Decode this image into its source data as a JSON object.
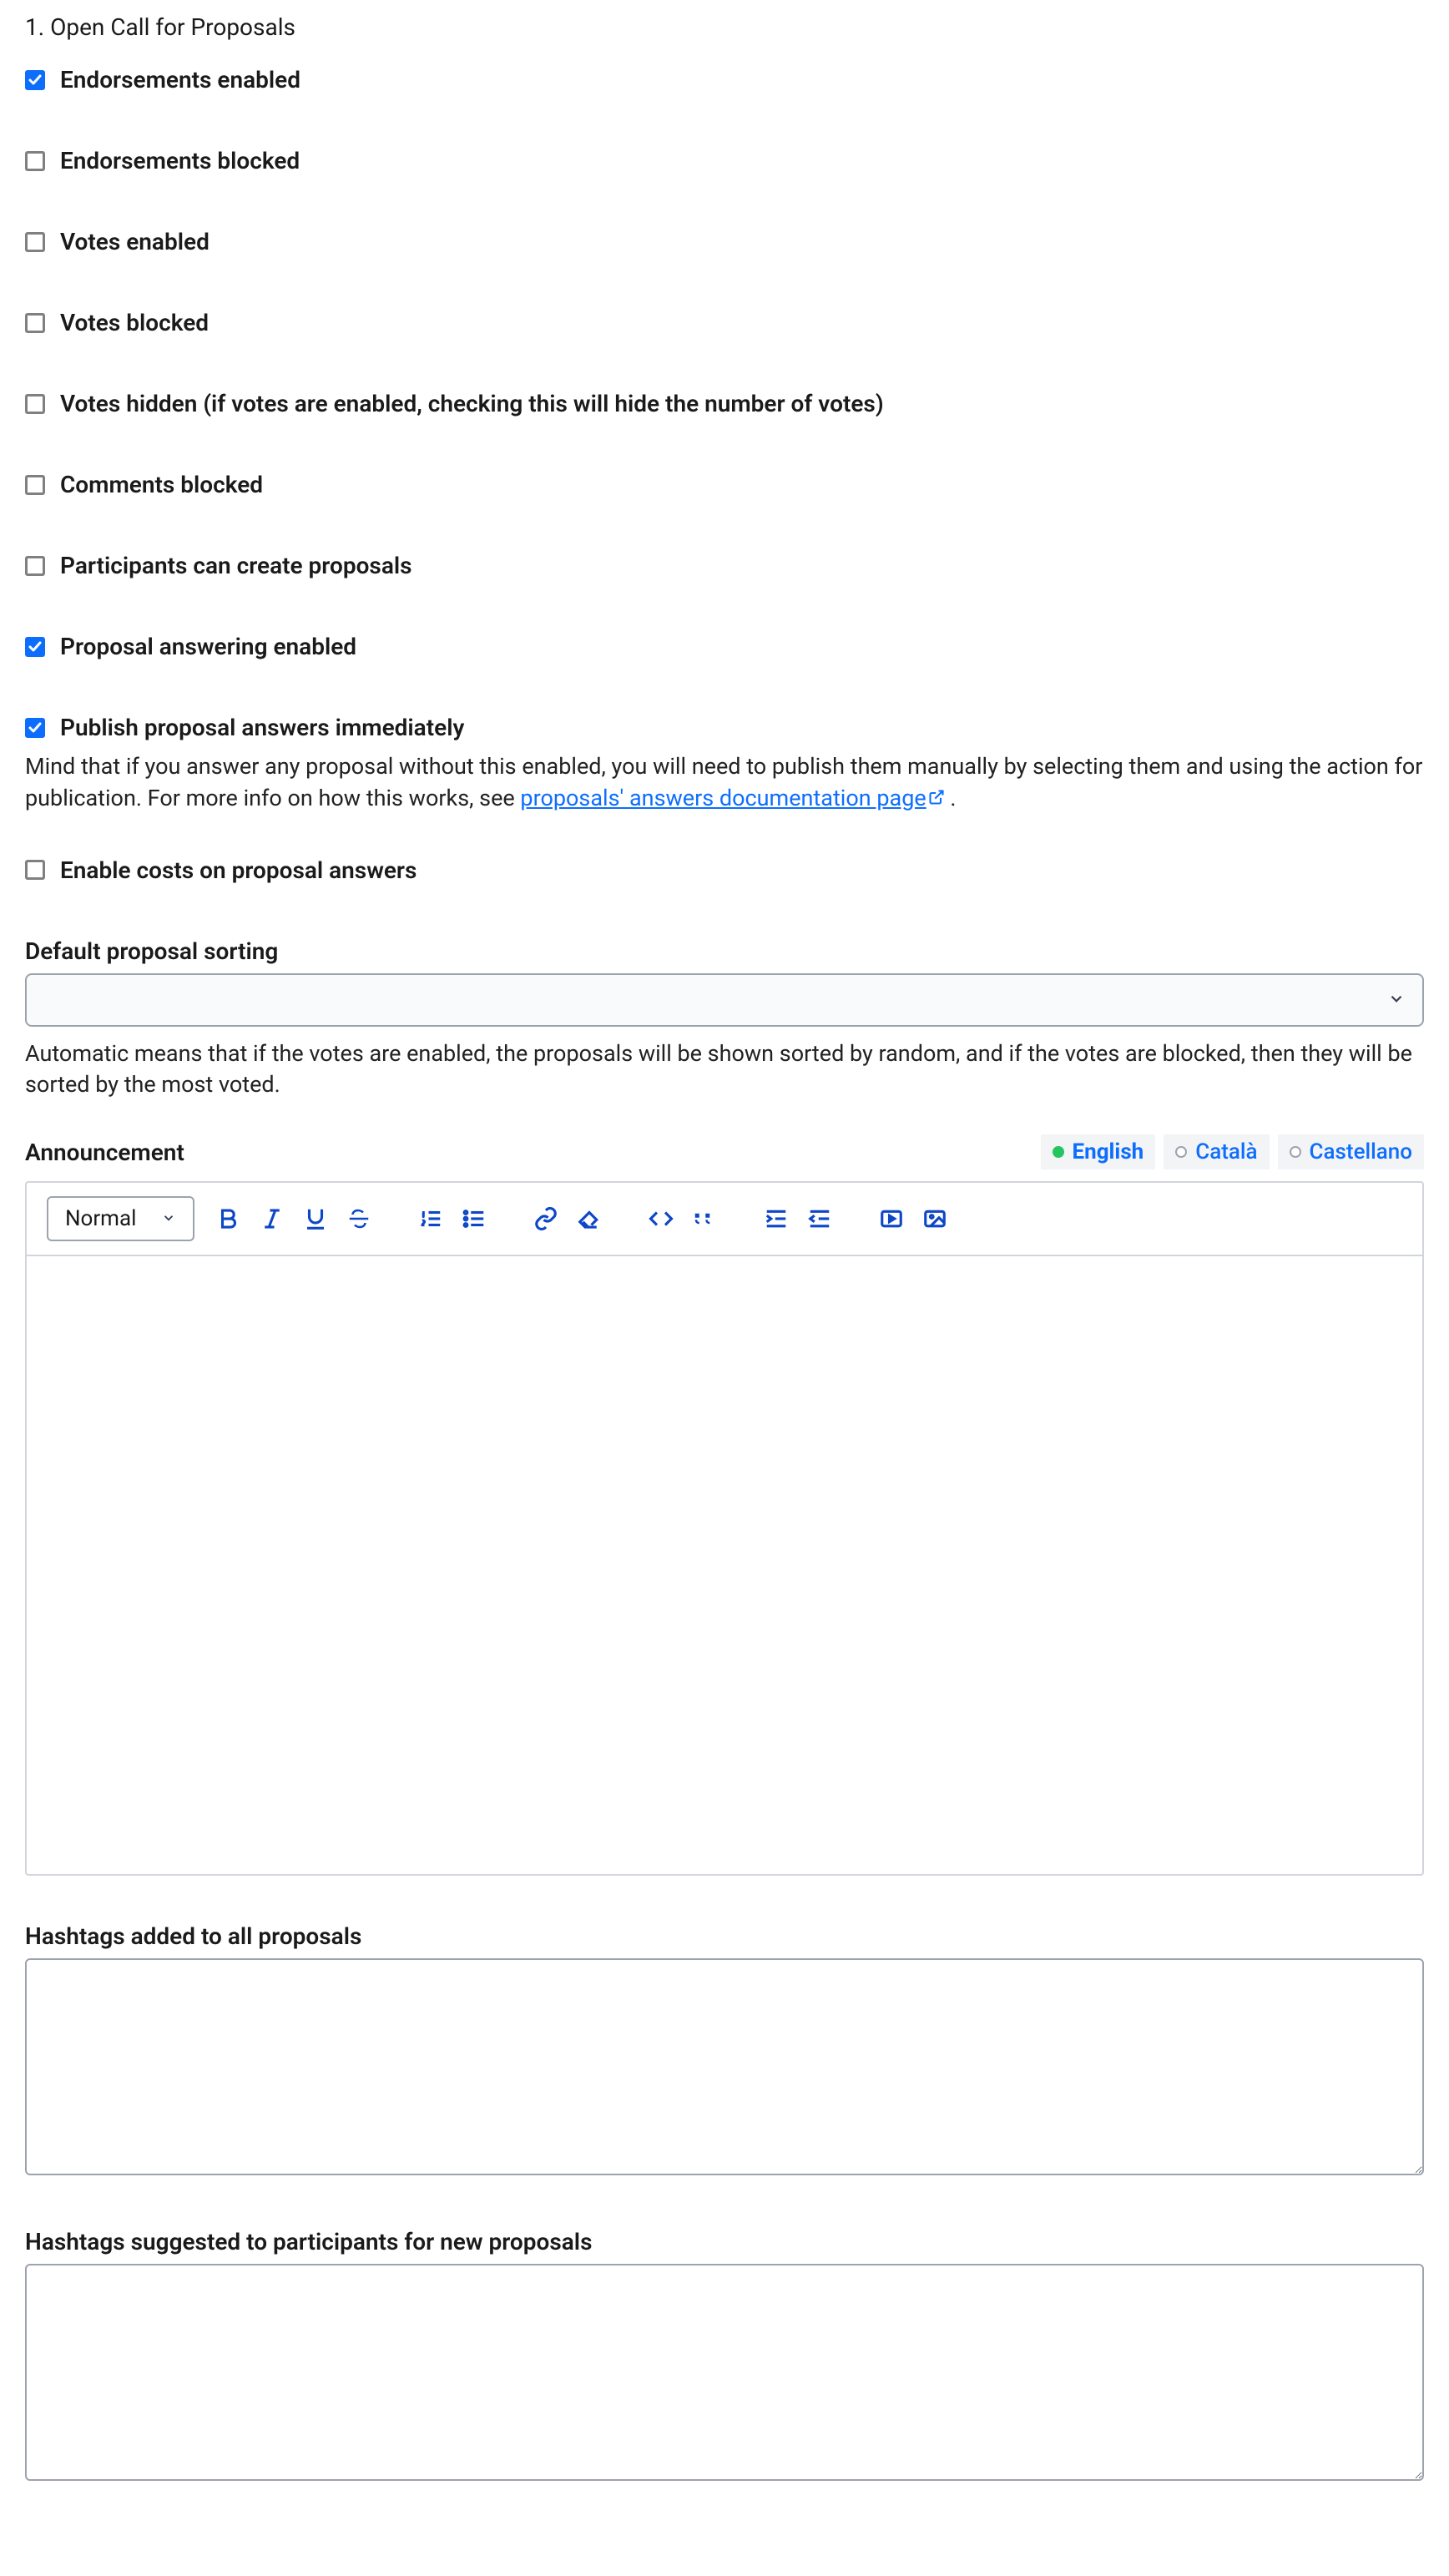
{
  "title": "Open Call for Proposals",
  "checkboxes": {
    "endorsements_enabled": {
      "label": "Endorsements enabled",
      "checked": true
    },
    "endorsements_blocked": {
      "label": "Endorsements blocked",
      "checked": false
    },
    "votes_enabled": {
      "label": "Votes enabled",
      "checked": false
    },
    "votes_blocked": {
      "label": "Votes blocked",
      "checked": false
    },
    "votes_hidden": {
      "label": "Votes hidden (if votes are enabled, checking this will hide the number of votes)",
      "checked": false
    },
    "comments_blocked": {
      "label": "Comments blocked",
      "checked": false
    },
    "participants_create": {
      "label": "Participants can create proposals",
      "checked": false
    },
    "proposal_answering": {
      "label": "Proposal answering enabled",
      "checked": true
    },
    "publish_answers": {
      "label": "Publish proposal answers immediately",
      "checked": true
    },
    "enable_costs": {
      "label": "Enable costs on proposal answers",
      "checked": false
    }
  },
  "publish_help": {
    "prefix": "Mind that if you answer any proposal without this enabled, you will need to publish them manually by selecting them and using the action for publication. For more info on how this works, see ",
    "link_text": "proposals' answers documentation page",
    "suffix": " ."
  },
  "sort": {
    "label": "Default proposal sorting",
    "value": "",
    "help": "Automatic means that if the votes are enabled, the proposals will be shown sorted by random, and if the votes are blocked, then they will be sorted by the most voted."
  },
  "announcement": {
    "label": "Announcement",
    "langs": [
      {
        "name": "English",
        "active": true
      },
      {
        "name": "Català",
        "active": false
      },
      {
        "name": "Castellano",
        "active": false
      }
    ],
    "format_select": "Normal",
    "content": ""
  },
  "hashtags_all": {
    "label": "Hashtags added to all proposals",
    "value": ""
  },
  "hashtags_suggested": {
    "label": "Hashtags suggested to participants for new proposals",
    "value": ""
  }
}
